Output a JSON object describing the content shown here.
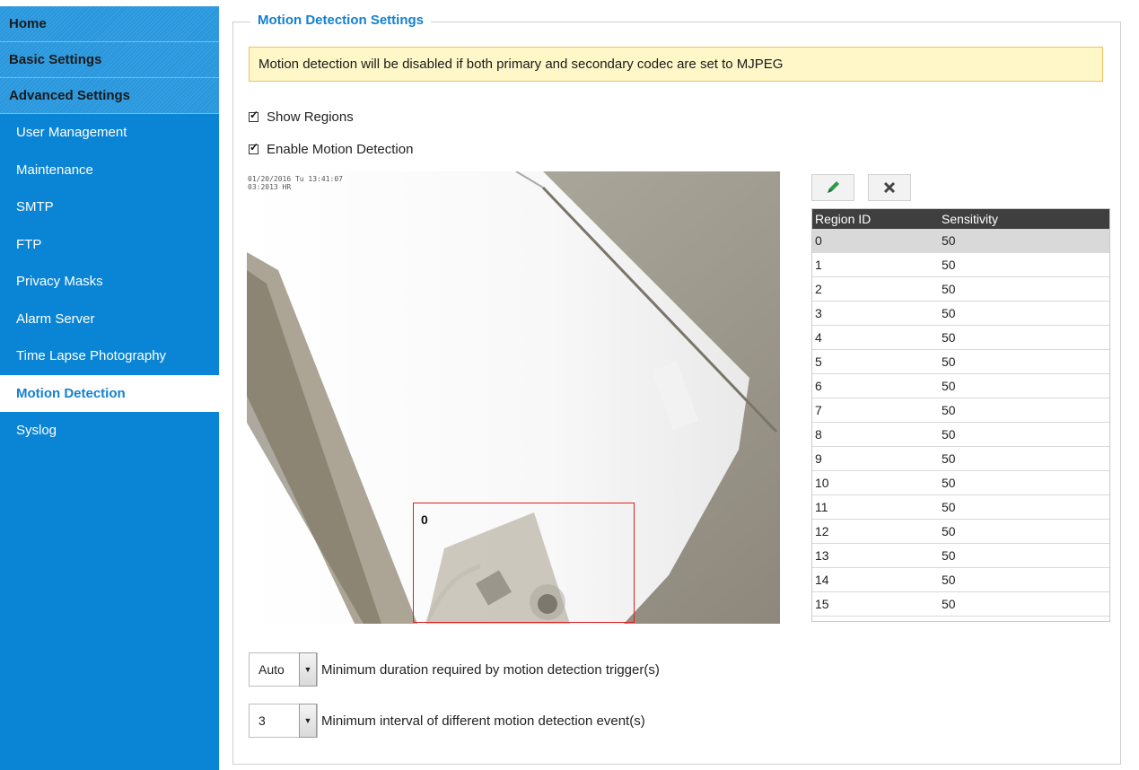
{
  "sidebar": {
    "sections": [
      {
        "label": "Home"
      },
      {
        "label": "Basic Settings"
      },
      {
        "label": "Advanced Settings"
      }
    ],
    "items": [
      {
        "label": "User Management"
      },
      {
        "label": "Maintenance"
      },
      {
        "label": "SMTP"
      },
      {
        "label": "FTP"
      },
      {
        "label": "Privacy Masks"
      },
      {
        "label": "Alarm Server"
      },
      {
        "label": "Time Lapse Photography"
      },
      {
        "label": "Motion Detection",
        "active": true
      },
      {
        "label": "Syslog"
      }
    ]
  },
  "main": {
    "legend": "Motion Detection Settings",
    "notice": "Motion detection will be disabled if both primary and secondary codec are set to MJPEG",
    "show_regions": {
      "label": "Show Regions",
      "checked": true
    },
    "enable_motion": {
      "label": "Enable Motion Detection",
      "checked": true
    },
    "camera": {
      "osd_line1": "01/20/2016 Tu 13:41:07",
      "osd_line2": "03:2013 HR",
      "region_label": "0"
    },
    "toolbar": {
      "edit_icon": "pencil-icon",
      "delete_icon": "close-icon"
    },
    "table": {
      "headers": [
        "Region ID",
        "Sensitivity"
      ],
      "rows": [
        [
          "0",
          "50"
        ],
        [
          "1",
          "50"
        ],
        [
          "2",
          "50"
        ],
        [
          "3",
          "50"
        ],
        [
          "4",
          "50"
        ],
        [
          "5",
          "50"
        ],
        [
          "6",
          "50"
        ],
        [
          "7",
          "50"
        ],
        [
          "8",
          "50"
        ],
        [
          "9",
          "50"
        ],
        [
          "10",
          "50"
        ],
        [
          "11",
          "50"
        ],
        [
          "12",
          "50"
        ],
        [
          "13",
          "50"
        ],
        [
          "14",
          "50"
        ],
        [
          "15",
          "50"
        ]
      ],
      "selected_row": 0
    },
    "min_duration": {
      "value": "Auto",
      "label": "Minimum duration required by motion detection trigger(s)"
    },
    "min_interval": {
      "value": "3",
      "label": "Minimum interval of different motion detection event(s)"
    }
  },
  "colors": {
    "sidebar": "#0a84d4",
    "accent": "#1580cf",
    "notice_bg": "#fff7c8",
    "notice_border": "#f0c060",
    "region_border": "#e02020"
  }
}
